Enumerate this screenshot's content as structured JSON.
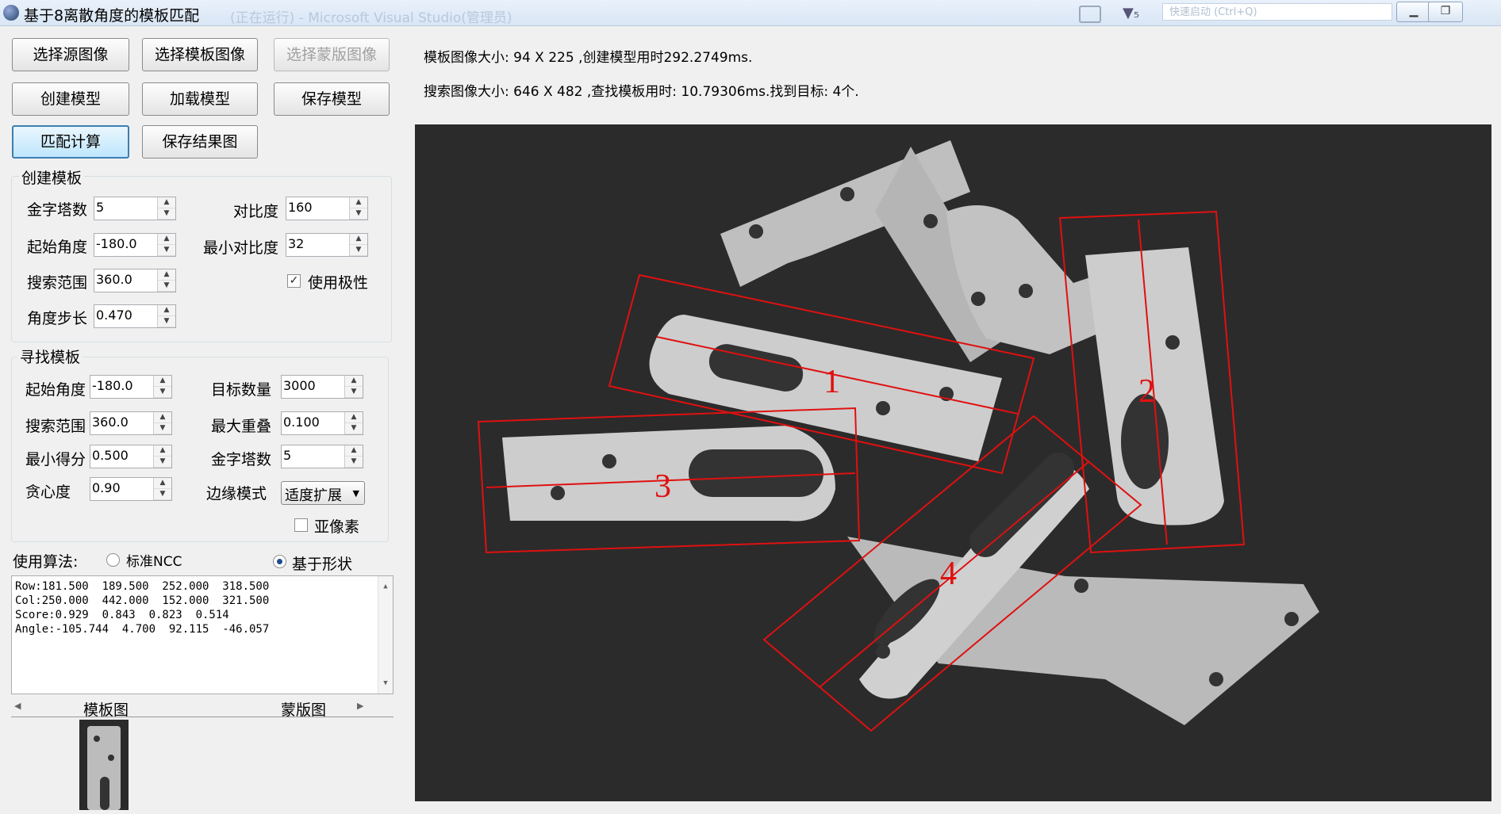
{
  "window": {
    "title": "基于8离散角度的模板匹配",
    "ghost_title": "(正在运行) - Microsoft Visual Studio(管理员)",
    "search_placeholder": "快速启动 (Ctrl+Q)"
  },
  "buttons": {
    "select_source": "选择源图像",
    "select_template": "选择模板图像",
    "select_mask": "选择蒙版图像",
    "create_model": "创建模型",
    "load_model": "加载模型",
    "save_model": "保存模型",
    "match": "匹配计算",
    "save_result": "保存结果图"
  },
  "create_group": {
    "title": "创建模板",
    "pyramid_label": "金字塔数",
    "pyramid_value": "5",
    "contrast_label": "对比度",
    "contrast_value": "160",
    "start_angle_label": "起始角度",
    "start_angle_value": "-180.0",
    "min_contrast_label": "最小对比度",
    "min_contrast_value": "32",
    "range_label": "搜索范围",
    "range_value": "360.0",
    "polarity_label": "使用极性",
    "polarity_checked": true,
    "step_label": "角度步长",
    "step_value": "0.470"
  },
  "find_group": {
    "title": "寻找模板",
    "start_angle_label": "起始角度",
    "start_angle_value": "-180.0",
    "target_count_label": "目标数量",
    "target_count_value": "3000",
    "range_label": "搜索范围",
    "range_value": "360.0",
    "max_overlap_label": "最大重叠",
    "max_overlap_value": "0.100",
    "min_score_label": "最小得分",
    "min_score_value": "0.500",
    "pyramid_label": "金字塔数",
    "pyramid_value": "5",
    "greedy_label": "贪心度",
    "greedy_value": "0.90",
    "edge_mode_label": "边缘模式",
    "edge_mode_value": "适度扩展",
    "subpixel_label": "亚像素",
    "subpixel_checked": false
  },
  "algorithm": {
    "label": "使用算法:",
    "ncc": "标准NCC",
    "shape": "基于形状",
    "selected": "shape"
  },
  "results": [
    "Row:181.500  189.500  252.000  318.500",
    "Col:250.000  442.000  152.000  321.500",
    "Score:0.929  0.843  0.823  0.514",
    "Angle:-105.744  4.700  92.115  -46.057"
  ],
  "tabs": [
    "模板图",
    "蒙版图"
  ],
  "info": {
    "line1": "模板图像大小: 94 X 225 ,创建模型用时292.2749ms.",
    "line2": "搜索图像大小: 646 X 482 ,查找模板用时: 10.79306ms.找到目标: 4个."
  },
  "match_labels": [
    "1",
    "2",
    "3",
    "4"
  ],
  "colors": {
    "match_box": "#e01010",
    "background": "#2b2b2b"
  }
}
